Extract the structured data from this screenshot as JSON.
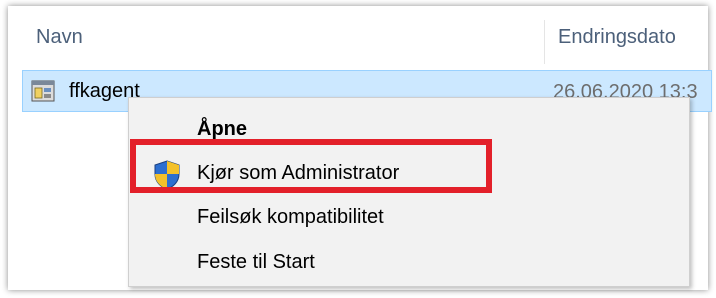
{
  "list": {
    "columns": {
      "name": "Navn",
      "date": "Endringsdato"
    },
    "rows": [
      {
        "icon": "application-icon",
        "name": "ffkagent",
        "date": "26.06.2020 13:3"
      }
    ]
  },
  "context_menu": {
    "items": [
      {
        "label": "Åpne",
        "bold": true
      },
      {
        "label": "Kjør som Administrator",
        "icon": "uac-shield-icon",
        "highlighted": true
      },
      {
        "label": "Feilsøk kompatibilitet"
      },
      {
        "label": "Feste til Start"
      }
    ]
  },
  "colors": {
    "selection": "#cce8ff",
    "highlight_border": "#e3202a",
    "header_text": "#4c607a"
  }
}
